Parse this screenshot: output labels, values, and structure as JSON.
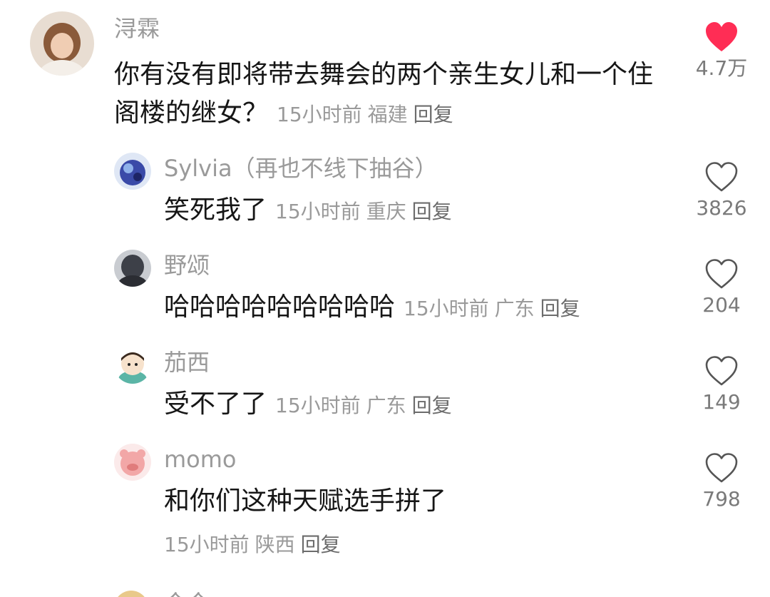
{
  "comments": [
    {
      "username": "浔霖",
      "text": "你有没有即将带去舞会的两个亲生女儿和一个住阁楼的继女？",
      "time": "15小时前",
      "location": "福建",
      "reply": "回复",
      "likes": "4.7万",
      "liked": true
    },
    {
      "username": "Sylvia（再也不线下抽谷）",
      "text": "笑死我了",
      "time": "15小时前",
      "location": "重庆",
      "reply": "回复",
      "likes": "3826",
      "liked": false
    },
    {
      "username": "野颂",
      "text": "哈哈哈哈哈哈哈哈哈",
      "time": "15小时前",
      "location": "广东",
      "reply": "回复",
      "likes": "204",
      "liked": false
    },
    {
      "username": "茄西",
      "text": "受不了了",
      "time": "15小时前",
      "location": "广东",
      "reply": "回复",
      "likes": "149",
      "liked": false
    },
    {
      "username": "momo",
      "text": "和你们这种天赋选手拼了",
      "time": "15小时前",
      "location": "陕西",
      "reply": "回复",
      "likes": "798",
      "liked": false
    }
  ],
  "next_comment": {
    "username": "今今"
  },
  "colors": {
    "liked_heart": "#ff2d55",
    "meta_gray": "#9a9a9a",
    "text": "#161616"
  },
  "icons": {
    "liked": "heart-filled-icon",
    "unliked": "heart-outline-icon"
  }
}
